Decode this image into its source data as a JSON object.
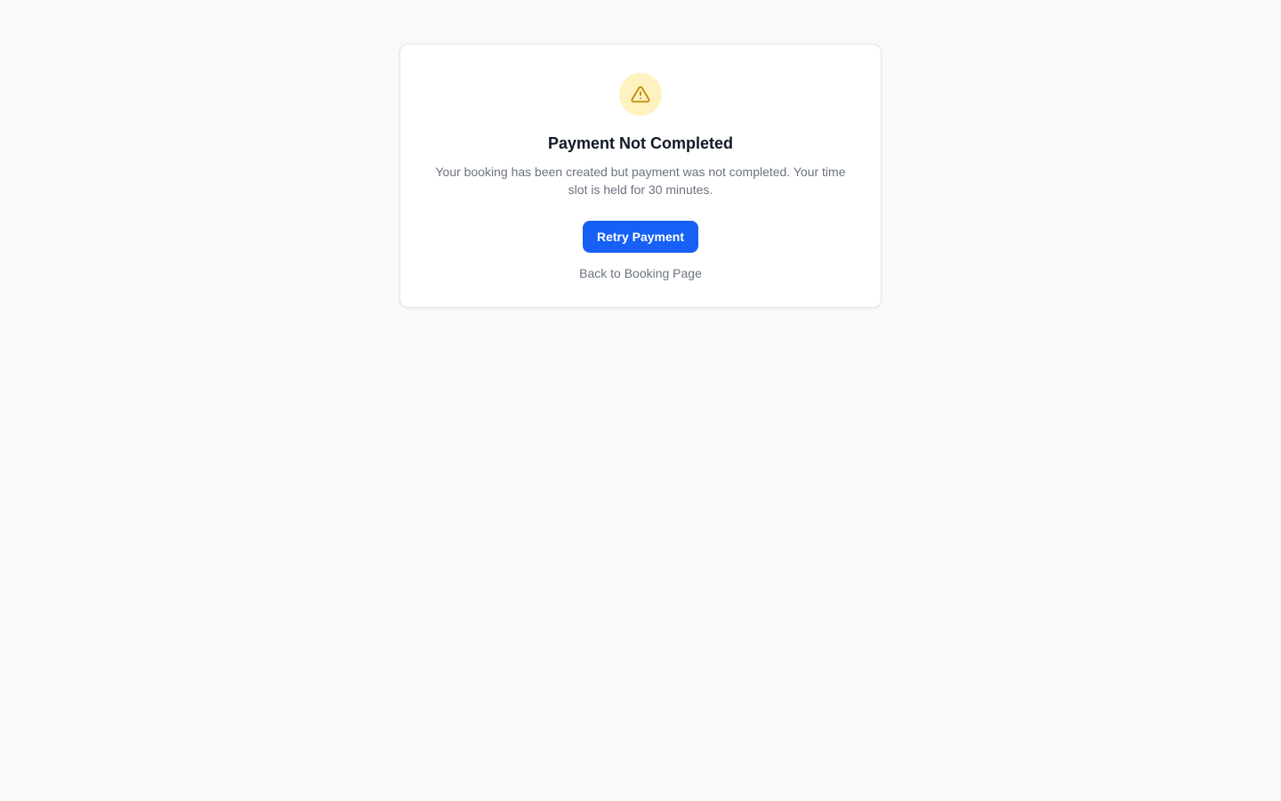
{
  "dialog": {
    "icon": "warning-triangle-icon",
    "title": "Payment Not Completed",
    "message": "Your booking has been created but payment was not completed. Your time slot is held for 30 minutes.",
    "retry_label": "Retry Payment",
    "back_label": "Back to Booking Page"
  },
  "colors": {
    "background": "#f8f9fb",
    "card": "#ffffff",
    "icon_bg": "#fef3c0",
    "icon_fg": "#c48a06",
    "primary": "#1660f5",
    "title": "#111827",
    "muted": "#6b7280"
  }
}
